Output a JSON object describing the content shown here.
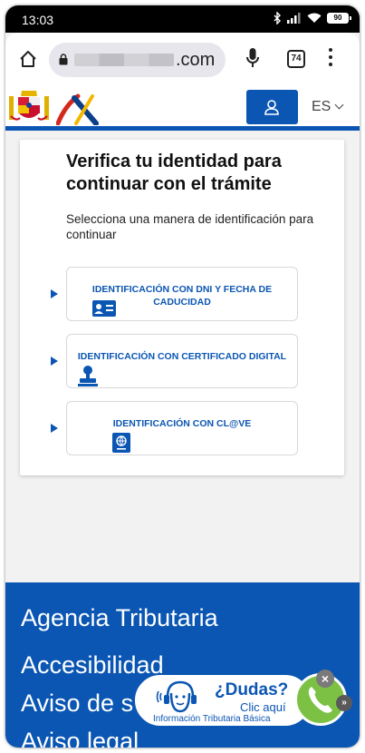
{
  "status_bar": {
    "time": "13:03",
    "battery": "90",
    "icons": [
      "bluetooth-icon",
      "signal-icon",
      "wifi-icon",
      "battery-icon"
    ]
  },
  "browser": {
    "url_suffix": ".com",
    "tab_count": "74"
  },
  "header": {
    "language": "ES",
    "brand_color": "#0b56b3"
  },
  "card": {
    "title": "Verifica tu identidad para continuar con el trámite",
    "subtitle": "Selecciona una manera de identificación para continuar",
    "options": [
      {
        "label": "IDENTIFICACIÓN CON DNI Y FECHA DE CADUCIDAD",
        "icon": "id-card-icon"
      },
      {
        "label": "IDENTIFICACIÓN CON CERTIFICADO DIGITAL",
        "icon": "stamp-icon"
      },
      {
        "label": "IDENTIFICACIÓN CON CL@VE",
        "icon": "passport-icon"
      }
    ]
  },
  "footer": {
    "links": [
      "Agencia Tributaria",
      "Accesibilidad",
      "Aviso de s",
      "Aviso legal"
    ]
  },
  "help_widget": {
    "title": "¿Dudas?",
    "action": "Clic aquí",
    "caption": "Información Tributaria Básica"
  }
}
